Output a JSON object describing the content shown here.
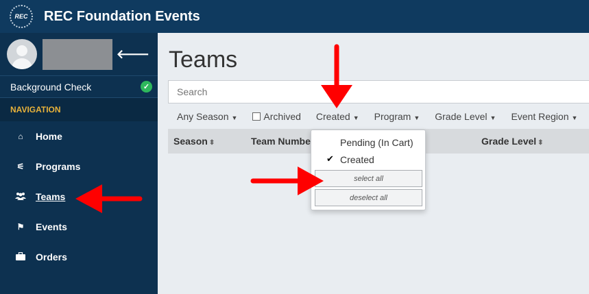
{
  "app": {
    "logo_text": "REC",
    "title": "REC Foundation Events"
  },
  "sidebar": {
    "collapse_icon": "arrow-left-icon",
    "background_check": "Background Check",
    "nav_header": "NAVIGATION",
    "items": [
      {
        "label": "Home",
        "icon": "home-icon",
        "glyph": "⌂"
      },
      {
        "label": "Programs",
        "icon": "programs-icon",
        "glyph": "⚟"
      },
      {
        "label": "Teams",
        "icon": "users-icon",
        "glyph": "👥"
      },
      {
        "label": "Events",
        "icon": "flag-icon",
        "glyph": "⚑"
      },
      {
        "label": "Orders",
        "icon": "briefcase-icon",
        "glyph": "▰"
      }
    ],
    "active": "Teams"
  },
  "main": {
    "title": "Teams",
    "search_placeholder": "Search",
    "filters": [
      {
        "label": "Any Season"
      },
      {
        "label": "Archived"
      },
      {
        "label": "Created"
      },
      {
        "label": "Program"
      },
      {
        "label": "Grade Level"
      },
      {
        "label": "Event Region"
      }
    ],
    "columns": [
      "Season",
      "Team Number",
      "Grade Level"
    ],
    "dropdown": {
      "options": [
        {
          "label": "Pending (In Cart)",
          "checked": false
        },
        {
          "label": "Created",
          "checked": true
        }
      ],
      "select_all": "select all",
      "deselect_all": "deselect all"
    }
  },
  "colors": {
    "topbar": "#0f3a5f",
    "sidebar": "#0d3150",
    "accent": "#e8b23a",
    "annotation": "#ff0000"
  }
}
